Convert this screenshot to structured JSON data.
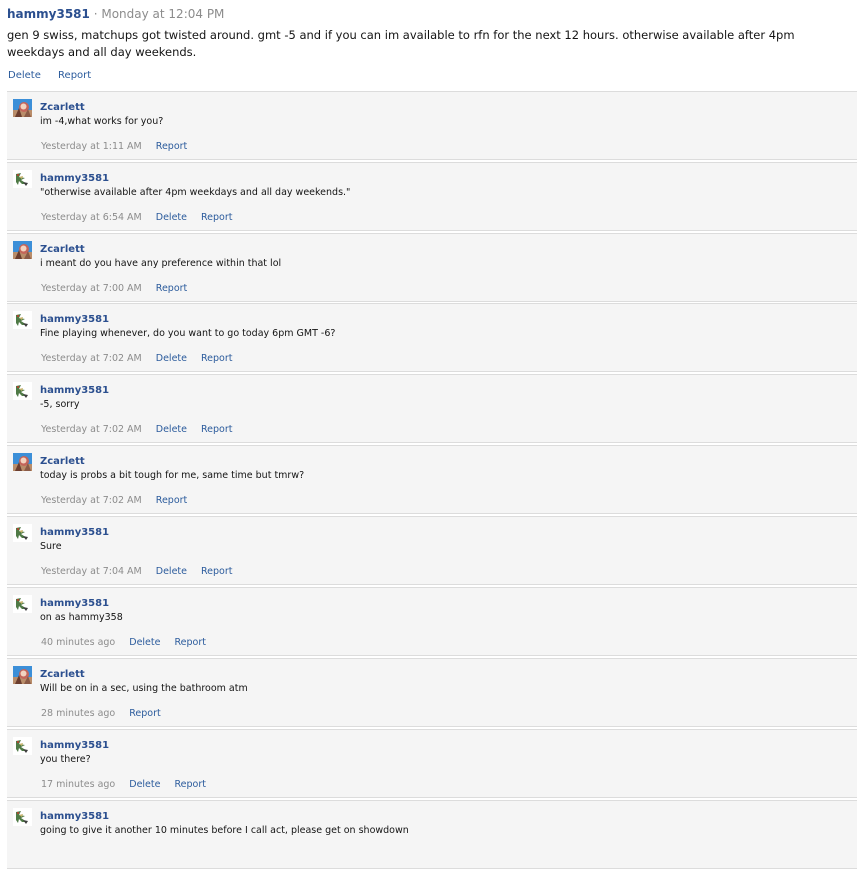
{
  "post": {
    "author": "hammy3581",
    "separator": "·",
    "time": "Monday at 12:04 PM",
    "body": "gen 9 swiss, matchups got twisted around. gmt -5 and if you can im available to rfn for the next 12 hours. otherwise available after 4pm weekdays and all day weekends.",
    "actions": {
      "delete": "Delete",
      "report": "Report"
    }
  },
  "comments": [
    {
      "author": "Zcarlett",
      "avatar": "zcarlett-avatar",
      "text": "im -4,what works for you?",
      "time": "Yesterday at 1:11 AM",
      "delete": "",
      "report": "Report"
    },
    {
      "author": "hammy3581",
      "avatar": "hammy-avatar",
      "text": "\"otherwise available after 4pm weekdays and all day weekends.\"",
      "time": "Yesterday at 6:54 AM",
      "delete": "Delete",
      "report": "Report"
    },
    {
      "author": "Zcarlett",
      "avatar": "zcarlett-avatar",
      "text": "i meant do you have any preference within that lol",
      "time": "Yesterday at 7:00 AM",
      "delete": "",
      "report": "Report"
    },
    {
      "author": "hammy3581",
      "avatar": "hammy-avatar",
      "text": "Fine playing whenever, do you want to go today 6pm GMT -6?",
      "time": "Yesterday at 7:02 AM",
      "delete": "Delete",
      "report": "Report"
    },
    {
      "author": "hammy3581",
      "avatar": "hammy-avatar",
      "text": "-5, sorry",
      "time": "Yesterday at 7:02 AM",
      "delete": "Delete",
      "report": "Report"
    },
    {
      "author": "Zcarlett",
      "avatar": "zcarlett-avatar",
      "text": "today is probs a bit tough for me, same time but tmrw?",
      "time": "Yesterday at 7:02 AM",
      "delete": "",
      "report": "Report"
    },
    {
      "author": "hammy3581",
      "avatar": "hammy-avatar",
      "text": "Sure",
      "time": "Yesterday at 7:04 AM",
      "delete": "Delete",
      "report": "Report"
    },
    {
      "author": "hammy3581",
      "avatar": "hammy-avatar",
      "text": "on as hammy358",
      "time": "40 minutes ago",
      "delete": "Delete",
      "report": "Report"
    },
    {
      "author": "Zcarlett",
      "avatar": "zcarlett-avatar",
      "text": "Will be on in a sec, using the bathroom atm",
      "time": "28 minutes ago",
      "delete": "",
      "report": "Report"
    },
    {
      "author": "hammy3581",
      "avatar": "hammy-avatar",
      "text": "you there?",
      "time": "17 minutes ago",
      "delete": "Delete",
      "report": "Report"
    },
    {
      "author": "hammy3581",
      "avatar": "hammy-avatar",
      "text": "going to give it another 10 minutes before I call act, please get on showdown",
      "time": "",
      "delete": "",
      "report": ""
    }
  ]
}
